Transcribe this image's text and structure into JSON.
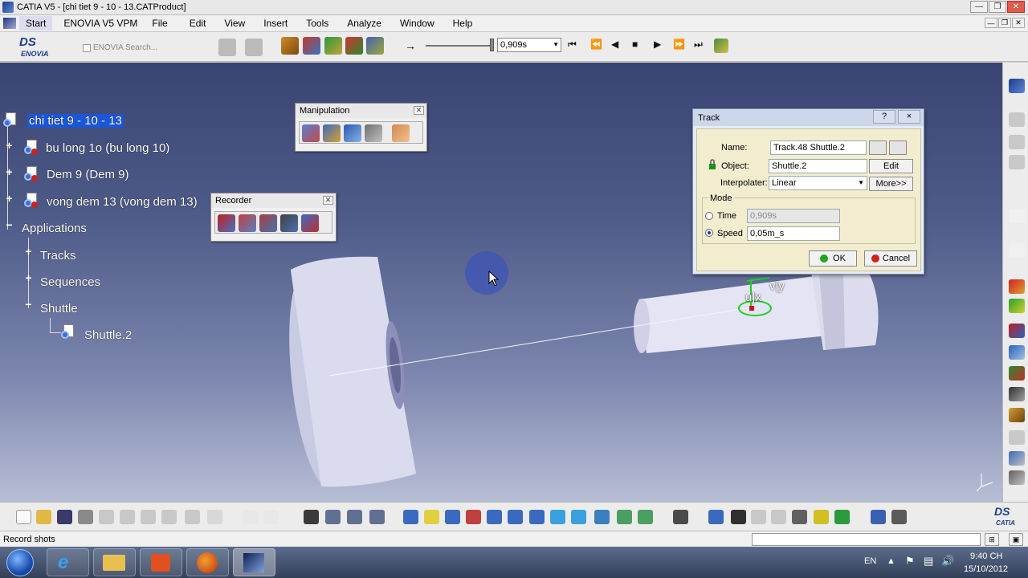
{
  "window": {
    "title": "CATIA V5 - [chi tiet 9 - 10 - 13.CATProduct]"
  },
  "menu": [
    "Start",
    "ENOVIA V5 VPM",
    "File",
    "Edit",
    "View",
    "Insert",
    "Tools",
    "Analyze",
    "Window",
    "Help"
  ],
  "toolbar": {
    "enovia_search": "ENOVIA Search...",
    "time_value": "0,909s"
  },
  "tree": {
    "root": "chi tiet 9 - 10 - 13",
    "nodes": [
      "bu long 1o (bu long 10)",
      "Dem 9 (Dem 9)",
      "vong dem 13 (vong dem 13)",
      "Applications",
      "Tracks",
      "Sequences",
      "Shuttle",
      "Shuttle.2"
    ]
  },
  "manipulation": {
    "title": "Manipulation"
  },
  "recorder": {
    "title": "Recorder"
  },
  "track_dialog": {
    "title": "Track",
    "help": "?",
    "close": "×",
    "name_label": "Name:",
    "name_value": "Track.48 Shuttle.2",
    "object_label": "Object:",
    "object_value": "Shuttle.2",
    "edit_label": "Edit",
    "interpolater_label": "Interpolater:",
    "interpolater_value": "Linear",
    "more_label": "More>>",
    "mode_label": "Mode",
    "time_label": "Time",
    "time_value": "0,909s",
    "speed_label": "Speed",
    "speed_value": "0,05m_s",
    "ok_label": "OK",
    "cancel_label": "Cancel"
  },
  "axes": {
    "u": "u|x",
    "v": "v|y"
  },
  "status": {
    "message": "Record shots"
  },
  "taskbar": {
    "lang": "EN",
    "time": "9:40 CH",
    "date": "15/10/2012"
  },
  "colors": {
    "selection": "#1a56d8",
    "viewport_top": "#3a4472",
    "viewport_bottom": "#b7bed6"
  }
}
